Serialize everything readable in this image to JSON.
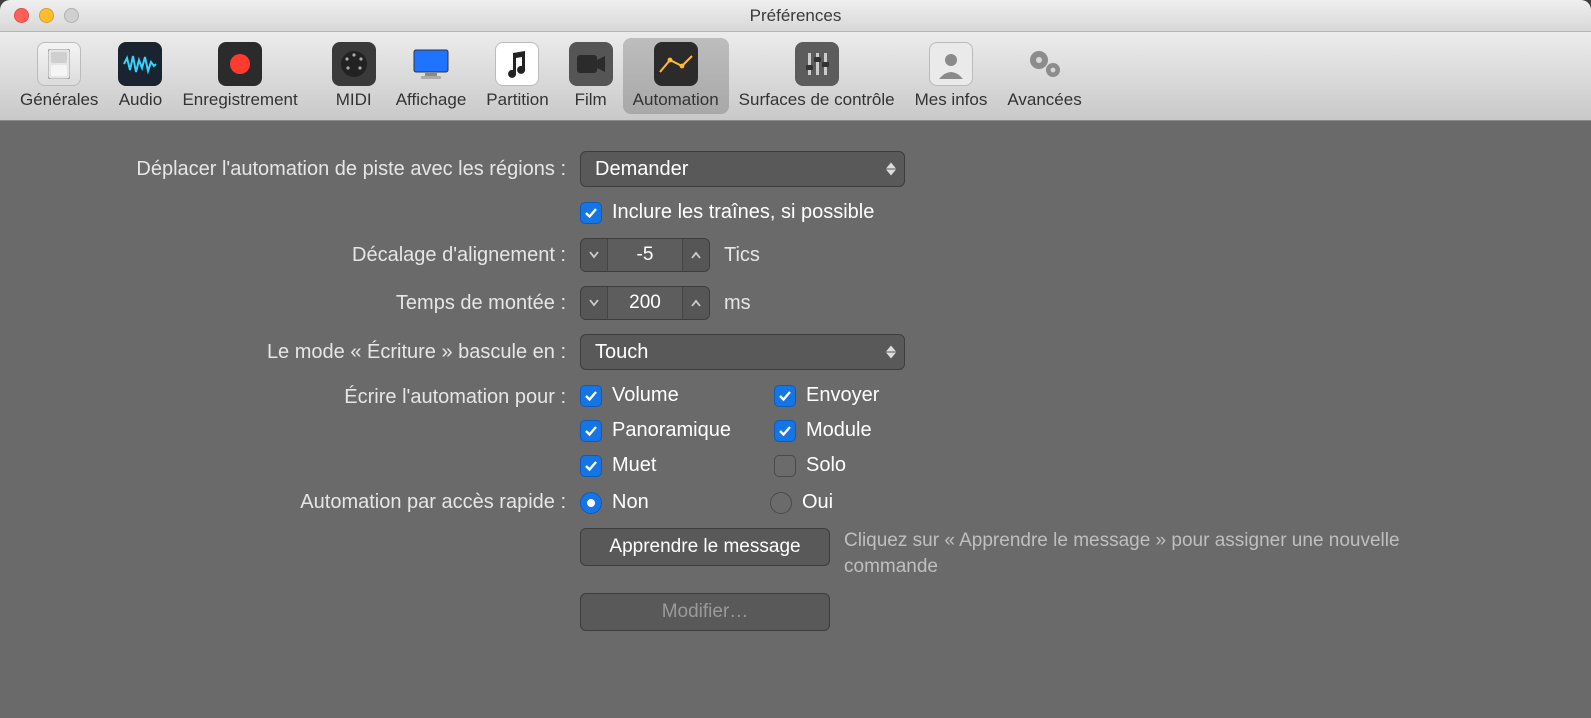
{
  "window": {
    "title": "Préférences"
  },
  "toolbar": {
    "tabs": [
      {
        "id": "general",
        "label": "Générales"
      },
      {
        "id": "audio",
        "label": "Audio"
      },
      {
        "id": "recording",
        "label": "Enregistrement"
      },
      {
        "id": "midi",
        "label": "MIDI"
      },
      {
        "id": "display",
        "label": "Affichage"
      },
      {
        "id": "score",
        "label": "Partition"
      },
      {
        "id": "movie",
        "label": "Film"
      },
      {
        "id": "automation",
        "label": "Automation"
      },
      {
        "id": "control-surfaces",
        "label": "Surfaces de contrôle"
      },
      {
        "id": "my-info",
        "label": "Mes infos"
      },
      {
        "id": "advanced",
        "label": "Avancées"
      }
    ],
    "active": "automation"
  },
  "form": {
    "move_label": "Déplacer l'automation de piste avec les régions :",
    "move_value": "Demander",
    "include_tails": {
      "label": "Inclure les traînes, si possible",
      "checked": true
    },
    "snap_offset": {
      "label": "Décalage d'alignement :",
      "value": "-5",
      "unit": "Tics"
    },
    "ramp_time": {
      "label": "Temps de montée :",
      "value": "200",
      "unit": "ms"
    },
    "write_mode": {
      "label": "Le mode « Écriture » bascule en :",
      "value": "Touch"
    },
    "write_for": {
      "label": "Écrire l'automation pour :",
      "items": [
        {
          "id": "volume",
          "label": "Volume",
          "checked": true
        },
        {
          "id": "send",
          "label": "Envoyer",
          "checked": true
        },
        {
          "id": "pan",
          "label": "Panoramique",
          "checked": true
        },
        {
          "id": "module",
          "label": "Module",
          "checked": true
        },
        {
          "id": "mute",
          "label": "Muet",
          "checked": true
        },
        {
          "id": "solo",
          "label": "Solo",
          "checked": false
        }
      ]
    },
    "quick_access": {
      "label": "Automation par accès rapide :",
      "options": [
        {
          "id": "no",
          "label": "Non",
          "selected": true
        },
        {
          "id": "yes",
          "label": "Oui",
          "selected": false
        }
      ]
    },
    "learn_button": "Apprendre le message",
    "learn_hint": "Cliquez sur « Apprendre le message » pour assigner une nouvelle commande",
    "edit_button": "Modifier…"
  }
}
